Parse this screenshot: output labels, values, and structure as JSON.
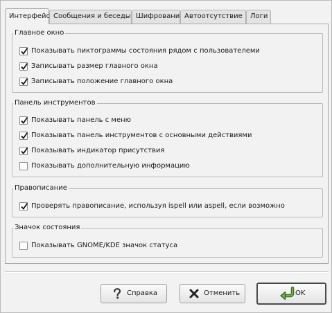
{
  "tabs": [
    {
      "label": "Интерфейс",
      "active": true
    },
    {
      "label": "Сообщения и беседы",
      "active": false
    },
    {
      "label": "Шифрование",
      "active": false
    },
    {
      "label": "Автоотсутствие",
      "active": false
    },
    {
      "label": "Логи",
      "active": false
    }
  ],
  "groups": {
    "main_window": {
      "title": "Главное окно",
      "items": [
        {
          "label": "Показывать пиктограммы состояния рядом с пользователеми",
          "checked": true
        },
        {
          "label": "Записывать размер главного окна",
          "checked": true
        },
        {
          "label": "Записывать положение главного окна",
          "checked": true
        }
      ]
    },
    "toolbar": {
      "title": "Панель инструментов",
      "items": [
        {
          "label": "Показывать панель с меню",
          "checked": true
        },
        {
          "label": "Показывать панель инструментов с основными действиями",
          "checked": true
        },
        {
          "label": "Показывать индикатор присутствия",
          "checked": true
        },
        {
          "label": "Показывать дополнительную информацию",
          "checked": false
        }
      ]
    },
    "spelling": {
      "title": "Правописание",
      "items": [
        {
          "label": "Проверять правописание, используя ispell или aspell, если возможно",
          "checked": true
        }
      ]
    },
    "status_icon": {
      "title": "Значок состояния",
      "items": [
        {
          "label": "Показывать GNOME/KDE значок статуса",
          "checked": false
        }
      ]
    }
  },
  "buttons": {
    "help": "Справка",
    "cancel": "Отменить",
    "ok": "OK"
  },
  "icons": {
    "help": "help-icon",
    "cancel": "cancel-icon",
    "ok": "ok-icon"
  }
}
